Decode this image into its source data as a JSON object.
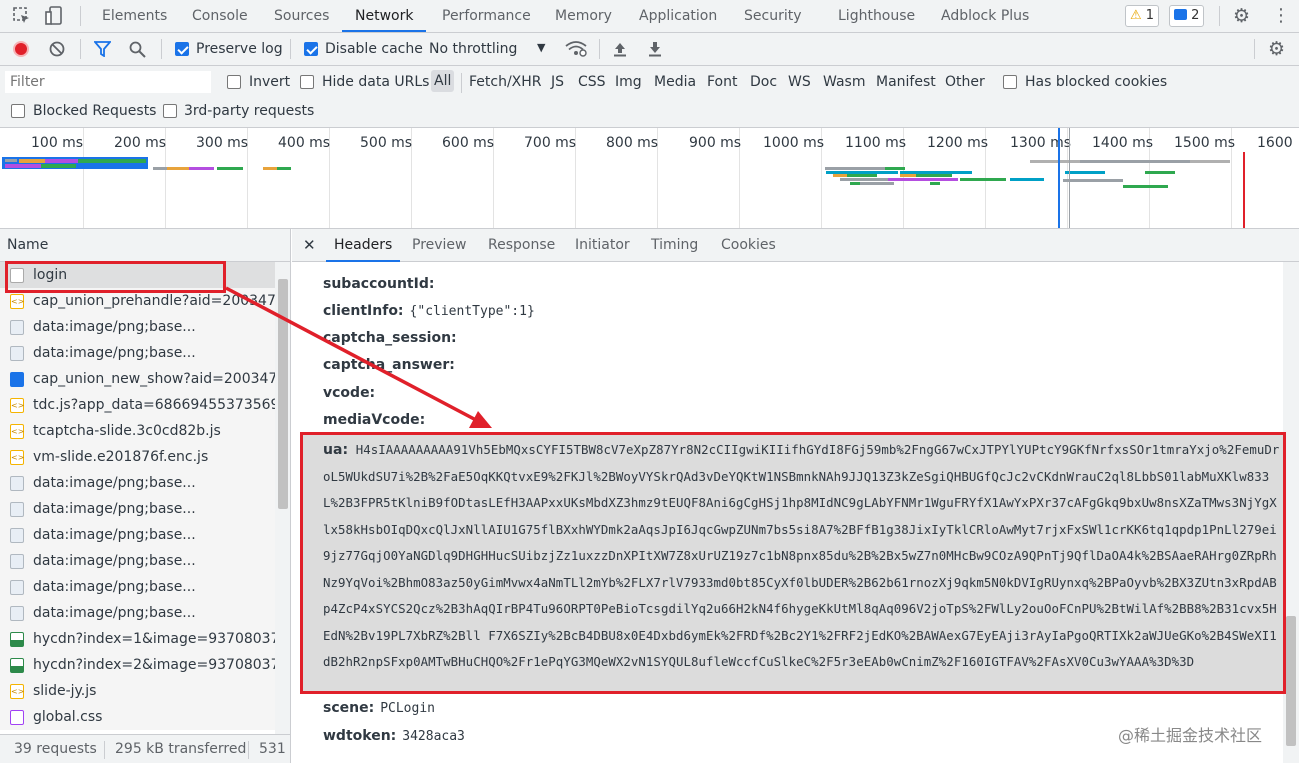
{
  "topbar": {
    "tabs": [
      "Elements",
      "Console",
      "Sources",
      "Network",
      "Performance",
      "Memory",
      "Application",
      "Security",
      "Lighthouse",
      "Adblock Plus"
    ],
    "active_tab": "Network",
    "warnings_count": "1",
    "messages_count": "2"
  },
  "toolbar": {
    "preserve_log": "Preserve log",
    "disable_cache": "Disable cache",
    "throttling": "No throttling"
  },
  "filterbar": {
    "filter_placeholder": "Filter",
    "invert": "Invert",
    "hide_data_urls": "Hide data URLs",
    "types": [
      "All",
      "Fetch/XHR",
      "JS",
      "CSS",
      "Img",
      "Media",
      "Font",
      "Doc",
      "WS",
      "Wasm",
      "Manifest",
      "Other"
    ],
    "has_blocked_cookies": "Has blocked cookies",
    "blocked_requests": "Blocked Requests",
    "third_party": "3rd-party requests"
  },
  "overview": {
    "ticks": [
      "100 ms",
      "200 ms",
      "300 ms",
      "400 ms",
      "500 ms",
      "600 ms",
      "700 ms",
      "800 ms",
      "900 ms",
      "1000 ms",
      "1100 ms",
      "1200 ms",
      "1300 ms",
      "1400 ms",
      "1500 ms",
      "1600"
    ]
  },
  "requests": {
    "header": "Name",
    "items": [
      {
        "name": "login",
        "icon": "blank-file-icon"
      },
      {
        "name": "cap_union_prehandle?aid=2003473...",
        "icon": "js-file-icon"
      },
      {
        "name": "data:image/png;base...",
        "icon": "image-file-icon"
      },
      {
        "name": "data:image/png;base...",
        "icon": "image-file-icon"
      },
      {
        "name": "cap_union_new_show?aid=2003473...",
        "icon": "document-icon"
      },
      {
        "name": "tdc.js?app_data=686694553735691...",
        "icon": "js-file-icon"
      },
      {
        "name": "tcaptcha-slide.3c0cd82b.js",
        "icon": "js-file-icon"
      },
      {
        "name": "vm-slide.e201876f.enc.js",
        "icon": "js-file-icon"
      },
      {
        "name": "data:image/png;base...",
        "icon": "image-file-icon"
      },
      {
        "name": "data:image/png;base...",
        "icon": "image-file-icon"
      },
      {
        "name": "data:image/png;base...",
        "icon": "image-file-icon"
      },
      {
        "name": "data:image/png;base...",
        "icon": "image-file-icon"
      },
      {
        "name": "data:image/png;base...",
        "icon": "image-file-icon"
      },
      {
        "name": "data:image/png;base...",
        "icon": "image-file-icon"
      },
      {
        "name": "hycdn?index=1&image=937080377...",
        "icon": "picture-icon"
      },
      {
        "name": "hycdn?index=2&image=937080377...",
        "icon": "picture-icon"
      },
      {
        "name": "slide-jy.js",
        "icon": "js-file-icon"
      },
      {
        "name": "global.css",
        "icon": "css-file-icon"
      }
    ]
  },
  "status": {
    "requests": "39 requests",
    "transferred": "295 kB transferred",
    "resources": "531"
  },
  "details": {
    "tabs": [
      "Headers",
      "Preview",
      "Response",
      "Initiator",
      "Timing",
      "Cookies"
    ],
    "active_tab": "Headers",
    "fields": [
      {
        "key": "subaccountId:",
        "value": ""
      },
      {
        "key": "clientInfo:",
        "value": "{\"clientType\":1}"
      },
      {
        "key": "captcha_session:",
        "value": ""
      },
      {
        "key": "captcha_answer:",
        "value": ""
      },
      {
        "key": "vcode:",
        "value": ""
      },
      {
        "key": "mediaVcode:",
        "value": ""
      }
    ],
    "ua_key": "ua:",
    "ua_value": "H4sIAAAAAAAAA91Vh5EbMQxsCYFI5TBW8cV7eXpZ87Yr8N2cCIIgwiKIIifhGYdI8FGj59mb%2FngG67wCxJTPYlYUPtcY9GKfNrfxsSOr1tmraYxjo%2FemuDroL5WUkdSU7i%2B%2FaE5OqKKQtvxE9%2FKJl%2BWoyVYSkrQAd3vDeYQKtW1NSBmnkNAh9JJQ13Z3kZeSgiQHBUGfQcJc2vCKdnWrauC2ql8LbbS01labMuXKlw833L%2B3FPR5tKlniB9fODtasLEfH3AAPxxUKsMbdXZ3hmz9tEUQF8Ani6gCgHSj1hp8MIdNC9gLAbYFNMr1WguFRYfX1AwYxPXr37cAFgGkq9bxUw8nsXZaTMws3NjYgXlx58kHsbOIqDQxcQlJxNllAIU1G75flBXxhWYDmk2aAqsJpI6JqcGwpZUNm7bs5si8A7%2BFfB1g38JixIyTklCRloAwMyt7rjxFxSWl1crKK6tq1qpdp1PnLl279ei9jz77GqjO0YaNGDlq9DHGHHucSUibzjZz1uxzzDnXPItXW7Z8xUrUZ19z7c1bN8pnx85du%2B%2Bx5wZ7n0MHcBw9COzA9QPnTj9QflDaOA4k%2BSAaeRAHrg0ZRpRhNz9YqVoi%2BhmO83az50yGimMvwx4aNmTLl2mYb%2FLX7rlV7933md0bt85CyXf0lbUDER%2B62b61rnozXj9qkm5N0kDVIgRUynxq%2BPaOyvb%2BX3ZUtn3xRpdABp4ZcP4xSYCS2Qcz%2B3hAqQIrBP4Tu96ORPT0PeBioTcsgdilYq2u66H2kN4f6hygeKkUtMl8qAq096V2joTpS%2FWlLy2ouOoFCnPU%2BtWilAf%2BB8%2B31cvx5HEdN%2Bv19PL7XbRZ%2Bll F7X6SZIy%2BcB4DBU8x0E4Dxbd6ymEk%2FRDf%2Bc2Y1%2FRF2jEdKO%2BAWAexG7EyEAji3rAyIaPgoQRTIXk2aWJUeGKo%2B4SWeXI1dB2hR2npSFxp0AMTwBHuCHQO%2Fr1ePqYG3MQeWX2vN1SYQUL8ufleWccfCuSlkeC%2F5r3eEAb0wCnimZ%2F160IGTFAV%2FAsXV0Cu3wYAAA%3D%3D",
    "more_fields": [
      {
        "key": "scene:",
        "value": "PCLogin"
      },
      {
        "key": "wdtoken:",
        "value": "3428aca3"
      }
    ]
  },
  "watermark": "@稀土掘金技术社区",
  "colors": {
    "accent": "#1a73e8",
    "highlight_red": "#e0202a",
    "record_red": "#e0202a"
  }
}
